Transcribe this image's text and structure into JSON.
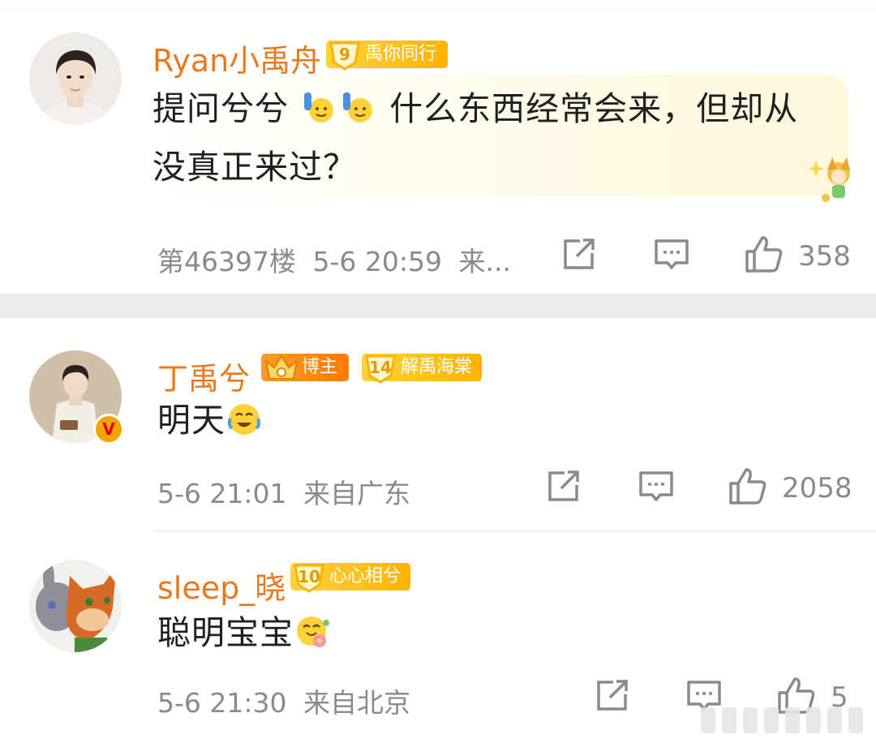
{
  "comments": [
    {
      "username": "Ryan小禹舟",
      "badges": [
        {
          "level": "9",
          "label": "禹你同行"
        }
      ],
      "text_line1_a": "提问兮兮",
      "text_line1_b": "什么东西经常会来，但却从",
      "text_line2": "没真正来过？",
      "floor": "第46397楼",
      "time": "5-6 20:59",
      "location": "来...",
      "likes": "358"
    },
    {
      "username": "丁禹兮",
      "badges": [
        {
          "label": "博主"
        },
        {
          "level": "14",
          "label": "解禹海棠"
        }
      ],
      "verified": "V",
      "text": "明天",
      "time": "5-6 21:01",
      "location": "来自广东",
      "likes": "2058"
    },
    {
      "username": "sleep_晓",
      "badges": [
        {
          "level": "10",
          "label": "心心相兮"
        }
      ],
      "text": "聪明宝宝",
      "time": "5-6 21:30",
      "location": "来自北京",
      "likes": "5"
    }
  ],
  "icons": [
    "share-icon",
    "comment-icon",
    "like-icon"
  ],
  "colors": {
    "username": "#e8791f",
    "badge": "#ffc21a",
    "meta": "#8a8a8a"
  }
}
